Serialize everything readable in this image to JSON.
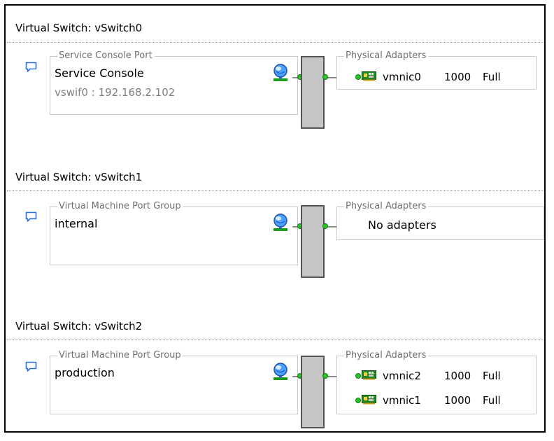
{
  "switches": [
    {
      "title": "Virtual Switch: vSwitch0",
      "port_group": {
        "legend": "Service Console Port",
        "name": "Service Console",
        "ip": "vswif0 : 192.168.2.102"
      },
      "adapters_legend": "Physical Adapters",
      "adapters": [
        {
          "name": "vmnic0",
          "speed": "1000",
          "duplex": "Full"
        }
      ]
    },
    {
      "title": "Virtual Switch: vSwitch1",
      "port_group": {
        "legend": "Virtual Machine Port Group",
        "name": "internal"
      },
      "adapters_legend": "Physical Adapters",
      "no_adapters": "No adapters"
    },
    {
      "title": "Virtual Switch: vSwitch2",
      "port_group": {
        "legend": "Virtual Machine Port Group",
        "name": "production"
      },
      "adapters_legend": "Physical Adapters",
      "adapters": [
        {
          "name": "vmnic2",
          "speed": "1000",
          "duplex": "Full"
        },
        {
          "name": "vmnic1",
          "speed": "1000",
          "duplex": "Full"
        }
      ]
    }
  ],
  "icons": {
    "comment": "speech-bubble-icon",
    "port": "network-port-globe-icon",
    "nic": "network-card-icon"
  },
  "colors": {
    "link_dot": "#28c628",
    "switch_bar": "#c6c6c6",
    "comment_icon": "#2a6fe8"
  }
}
